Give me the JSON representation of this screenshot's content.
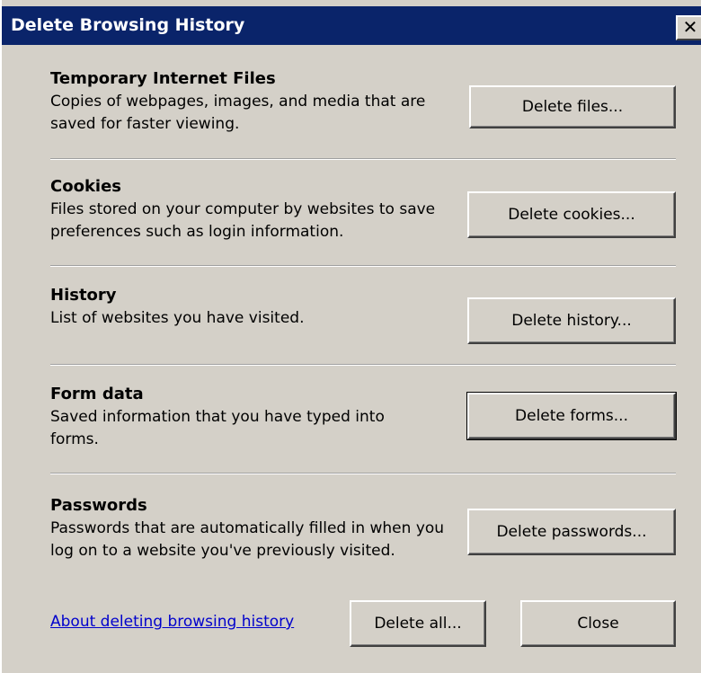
{
  "window": {
    "title": "Delete Browsing History",
    "close_glyph": "✕"
  },
  "sections": [
    {
      "heading": "Temporary Internet Files",
      "description": "Copies of webpages, images, and media that are saved for faster viewing.",
      "button_label": "Delete files..."
    },
    {
      "heading": "Cookies",
      "description": "Files stored on your computer by websites to save preferences such as login information.",
      "button_label": "Delete cookies..."
    },
    {
      "heading": "History",
      "description": "List of websites you have visited.",
      "button_label": "Delete history..."
    },
    {
      "heading": "Form data",
      "description": "Saved information that you have typed into forms.",
      "button_label": "Delete forms..."
    },
    {
      "heading": "Passwords",
      "description": "Passwords that are automatically filled in when you log on to a website you've previously visited.",
      "button_label": "Delete passwords..."
    }
  ],
  "footer": {
    "help_link": "About deleting browsing history",
    "delete_all_label": "Delete all...",
    "close_label": "Close"
  },
  "colors": {
    "title_bar": "#0a246a",
    "dialog_background": "#d4d0c8",
    "link": "#0000cc"
  }
}
